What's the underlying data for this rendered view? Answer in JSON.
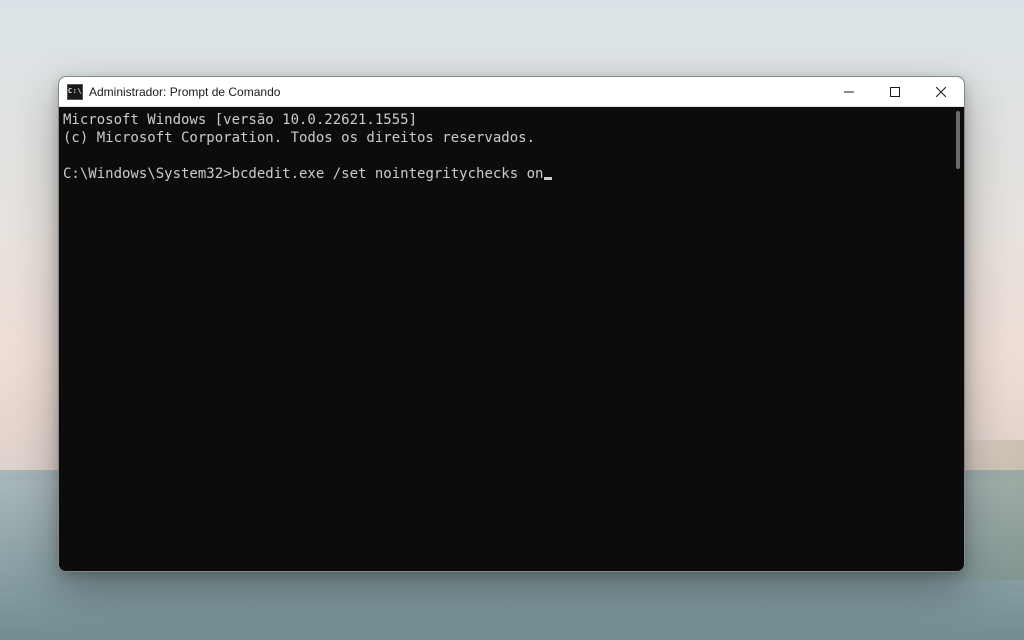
{
  "window": {
    "title": "Administrador: Prompt de Comando",
    "icon_label": "C:\\"
  },
  "titlebar": {
    "minimize_name": "minimize-button",
    "maximize_name": "maximize-button",
    "close_name": "close-button"
  },
  "terminal": {
    "line1": "Microsoft Windows [versão 10.0.22621.1555]",
    "line2": "(c) Microsoft Corporation. Todos os direitos reservados.",
    "blank": "",
    "prompt_path": "C:\\Windows\\System32>",
    "command": "bcdedit.exe /set nointegritychecks on"
  }
}
